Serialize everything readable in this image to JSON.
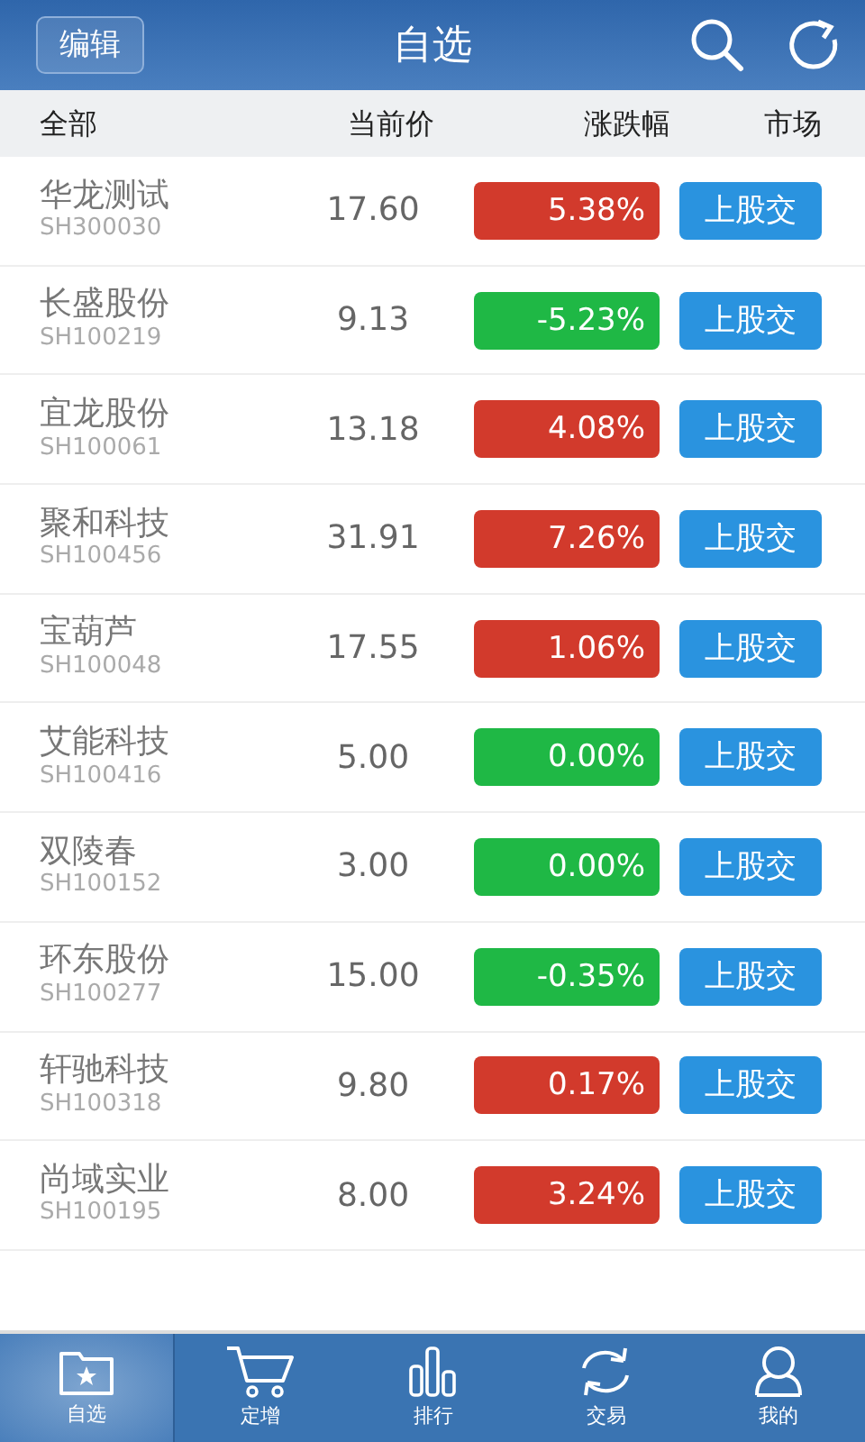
{
  "header": {
    "edit_button": "编辑",
    "title": "自选"
  },
  "columns": [
    "全部",
    "当前价",
    "涨跌幅",
    "市场"
  ],
  "rows": [
    {
      "name": "华龙测试",
      "code": "SH300030",
      "price": "17.60",
      "change": "5.38%",
      "kind": "up",
      "market": "上股交"
    },
    {
      "name": "长盛股份",
      "code": "SH100219",
      "price": "9.13",
      "change": "-5.23%",
      "kind": "down",
      "market": "上股交"
    },
    {
      "name": "宜龙股份",
      "code": "SH100061",
      "price": "13.18",
      "change": "4.08%",
      "kind": "up",
      "market": "上股交"
    },
    {
      "name": "聚和科技",
      "code": "SH100456",
      "price": "31.91",
      "change": "7.26%",
      "kind": "up",
      "market": "上股交"
    },
    {
      "name": "宝葫芦",
      "code": "SH100048",
      "price": "17.55",
      "change": "1.06%",
      "kind": "up",
      "market": "上股交"
    },
    {
      "name": "艾能科技",
      "code": "SH100416",
      "price": "5.00",
      "change": "0.00%",
      "kind": "down",
      "market": "上股交"
    },
    {
      "name": "双陵春",
      "code": "SH100152",
      "price": "3.00",
      "change": "0.00%",
      "kind": "down",
      "market": "上股交"
    },
    {
      "name": "环东股份",
      "code": "SH100277",
      "price": "15.00",
      "change": "-0.35%",
      "kind": "down",
      "market": "上股交"
    },
    {
      "name": "轩驰科技",
      "code": "SH100318",
      "price": "9.80",
      "change": "0.17%",
      "kind": "up",
      "market": "上股交"
    },
    {
      "name": "尚域实业",
      "code": "SH100195",
      "price": "8.00",
      "change": "3.24%",
      "kind": "up",
      "market": "上股交"
    }
  ],
  "tabs": [
    {
      "label": "自选",
      "kind": "folder",
      "selected": true
    },
    {
      "label": "定增",
      "kind": "cart",
      "selected": false
    },
    {
      "label": "排行",
      "kind": "bars",
      "selected": false
    },
    {
      "label": "交易",
      "kind": "sync",
      "selected": false
    },
    {
      "label": "我的",
      "kind": "user",
      "selected": false
    }
  ]
}
